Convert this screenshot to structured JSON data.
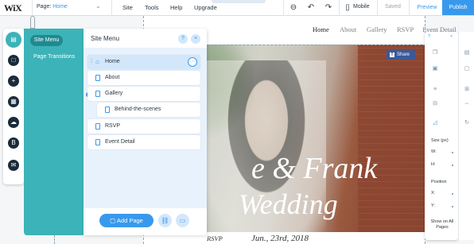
{
  "topbar": {
    "logo": "WiX",
    "page_label": "Page:",
    "page_value": "Home",
    "menus": [
      "Site",
      "Tools",
      "Help",
      "Upgrade"
    ],
    "mobile": "Mobile",
    "saved": "Saved",
    "preview": "Preview",
    "publish": "Publish"
  },
  "site": {
    "nav": [
      "Home",
      "About",
      "Gallery",
      "RSVP",
      "Event Detail"
    ],
    "hero_title": "e & Frank",
    "hero_sub": "Wedding",
    "share": "Share",
    "footer_rsvp": "RSVP",
    "footer_date": "Jun., 23rd, 2018"
  },
  "panel": {
    "tabs": [
      "Site Menu",
      "Page Transitions"
    ],
    "title": "Site Menu",
    "help": "?",
    "close": "×",
    "pages": [
      "Home",
      "About",
      "Gallery",
      "Behind-the-scenes",
      "RSVP",
      "Event Detail"
    ],
    "add_page": "Add Page",
    "more": "···"
  },
  "props": {
    "size_title": "Size (px)",
    "w": "W:",
    "h": "H:",
    "position_title": "Position",
    "x": "X:",
    "y": "Y:",
    "show_on_all": "Show on All Pages",
    "help": "?",
    "close": "×"
  },
  "colors": {
    "accent": "#3899ec",
    "teal": "#3cb3b8",
    "teal_dark": "#208a8f"
  }
}
